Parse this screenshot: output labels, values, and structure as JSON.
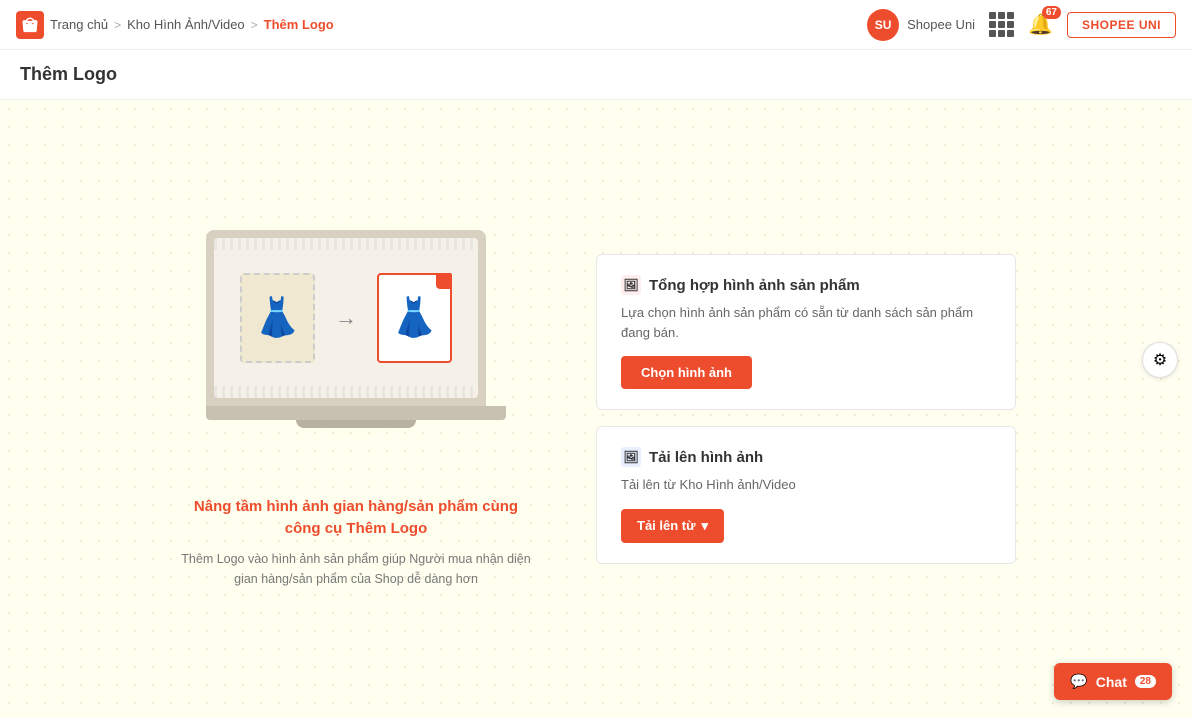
{
  "nav": {
    "breadcrumb_home": "Trang chủ",
    "breadcrumb_sep1": ">",
    "breadcrumb_middle": "Kho Hình Ảnh/Video",
    "breadcrumb_sep2": ">",
    "breadcrumb_current": "Thêm Logo",
    "shopee_uni_label": "Shopee Uni",
    "shopee_uni_btn": "SHOPEE UNI",
    "notif_count": "67"
  },
  "page": {
    "title": "Thêm Logo"
  },
  "illustration": {
    "promo_title": "Nâng tầm hình ảnh gian hàng/sản phẩm cùng công cụ Thêm Logo",
    "promo_desc": "Thêm Logo vào hình ảnh sản phẩm giúp Người mua nhận diện gian hàng/sản phẩm của Shop dễ dàng hơn"
  },
  "card1": {
    "icon": "🖼",
    "title": "Tổng hợp hình ảnh sản phẩm",
    "desc": "Lựa chọn hình ảnh sản phẩm có sẵn từ danh sách sản phẩm đang bán.",
    "btn": "Chọn hình ảnh"
  },
  "card2": {
    "icon": "🖼",
    "title": "Tải lên hình ảnh",
    "desc": "Tải lên từ Kho Hình ảnh/Video",
    "btn": "Tải lên từ"
  },
  "chat": {
    "label": "Chat",
    "badge": "28"
  },
  "support": {
    "icon": "⚙"
  }
}
